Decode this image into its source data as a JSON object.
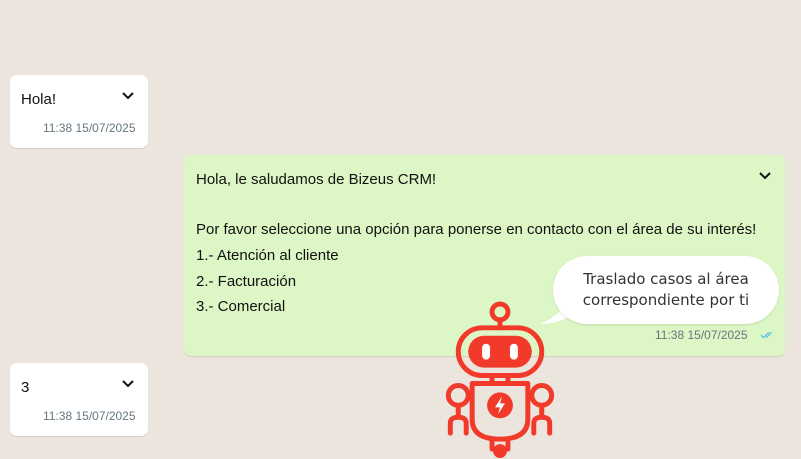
{
  "messages": [
    {
      "id": "m1",
      "direction": "incoming",
      "text": "Hola!",
      "time": "11:38 15/07/2025"
    },
    {
      "id": "m2",
      "direction": "outgoing",
      "lines": [
        "Hola, le saludamos de Bizeus CRM!",
        "",
        "Por favor seleccione una opción para ponerse en contacto con el área de su interés!",
        "1.- Atención al cliente",
        "2.- Facturación",
        "3.- Comercial"
      ],
      "time": "11:38 15/07/2025",
      "status": "read"
    },
    {
      "id": "m3",
      "direction": "incoming",
      "text": "3",
      "time": "11:38 15/07/2025"
    }
  ],
  "overlay": {
    "speech": [
      "Traslado casos al área",
      "correspondiente por ti"
    ],
    "bot_icon": "robot-mascot-icon",
    "accent_color": "#f23a2b"
  },
  "colors": {
    "background": "#ece5de",
    "incoming_bubble": "#ffffff",
    "outgoing_bubble": "#dcf7c5",
    "timestamp": "#667781",
    "read_ticks": "#53bdeb"
  }
}
